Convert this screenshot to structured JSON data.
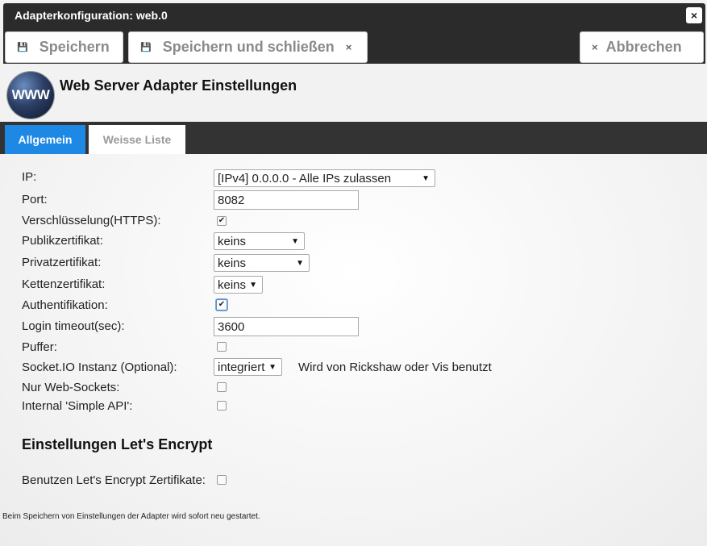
{
  "window": {
    "title": "Adapterkonfiguration: web.0",
    "close_icon": "×"
  },
  "toolbar": {
    "save_label": "Speichern",
    "save_close_label": "Speichern und schließen",
    "cancel_label": "Abbrechen",
    "save_icon": "💾",
    "x_icon": "×"
  },
  "header": {
    "logo_text": "WWW",
    "title": "Web Server Adapter Einstellungen"
  },
  "tabs": [
    {
      "label": "Allgemein",
      "active": true
    },
    {
      "label": "Weisse Liste",
      "active": false
    }
  ],
  "form": {
    "ip": {
      "label": "IP:",
      "value": "[IPv4] 0.0.0.0 - Alle IPs zulassen"
    },
    "port": {
      "label": "Port:",
      "value": "8082"
    },
    "https": {
      "label": "Verschlüsselung(HTTPS):",
      "checked": true
    },
    "public_cert": {
      "label": "Publikzertifikat:",
      "value": "keins"
    },
    "private_cert": {
      "label": "Privatzertifikat:",
      "value": "keins"
    },
    "chain_cert": {
      "label": "Kettenzertifikat:",
      "value": "keins"
    },
    "auth": {
      "label": "Authentifikation:",
      "checked": true
    },
    "login_timeout": {
      "label": "Login timeout(sec):",
      "value": "3600"
    },
    "cache": {
      "label": "Puffer:",
      "checked": false
    },
    "socketio": {
      "label": "Socket.IO Instanz (Optional):",
      "value": "integriert",
      "note": "Wird von Rickshaw oder Vis benutzt"
    },
    "websockets_only": {
      "label": "Nur Web-Sockets:",
      "checked": false
    },
    "simple_api": {
      "label": "Internal 'Simple API':",
      "checked": false
    }
  },
  "letsencrypt": {
    "title": "Einstellungen Let's Encrypt",
    "use": {
      "label": "Benutzen Let's Encrypt Zertifikate:",
      "checked": false
    }
  },
  "footer": {
    "note": "Beim Speichern von Einstellungen der Adapter wird sofort neu gestartet."
  },
  "icons": {
    "checkmark": "✔",
    "dropdown_arrow": "▼"
  }
}
